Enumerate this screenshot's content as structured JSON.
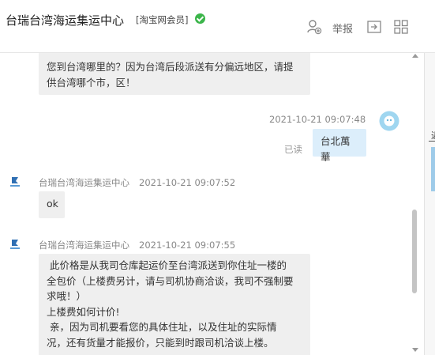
{
  "header": {
    "title": "台瑞台湾海运集运中心",
    "member_badge": "[淘宝网会员]",
    "report_label": "举报",
    "icons": [
      "user-plus-icon",
      "report-icon",
      "folder-arrow-icon",
      "grid-icon"
    ]
  },
  "messages": [
    {
      "text": "您到台湾哪里的？因为台湾后段派送有分偏远地区，请提供台湾哪个市，区！"
    },
    {
      "timestamp": "2021-10-21 09:07:48",
      "text": "台北萬華",
      "status": "已读"
    },
    {
      "sender": "台瑞台湾海运集运中心",
      "timestamp": "2021-10-21 09:07:52",
      "text": "ok"
    },
    {
      "sender": "台瑞台湾海运集运中心",
      "timestamp": "2021-10-21 09:07:55",
      "lines": [
        " 此价格是从我司仓库起运价至台湾派送到你住址一楼的",
        "全包价（上楼费另计，请与司机协商洽谈，我司不强制要",
        "求哦！）",
        "上楼费如何计价!",
        " 亲，因为司机要看您的具体住址，以及住址的实际情",
        "况，还有货量才能报价，只能到时跟司机洽谈上楼。"
      ]
    }
  ],
  "right_panel": {
    "tab_char": "近"
  },
  "colors": {
    "my_bubble": "#dceefb",
    "other_bubble": "#efefef",
    "verified": "#3bb54a"
  }
}
